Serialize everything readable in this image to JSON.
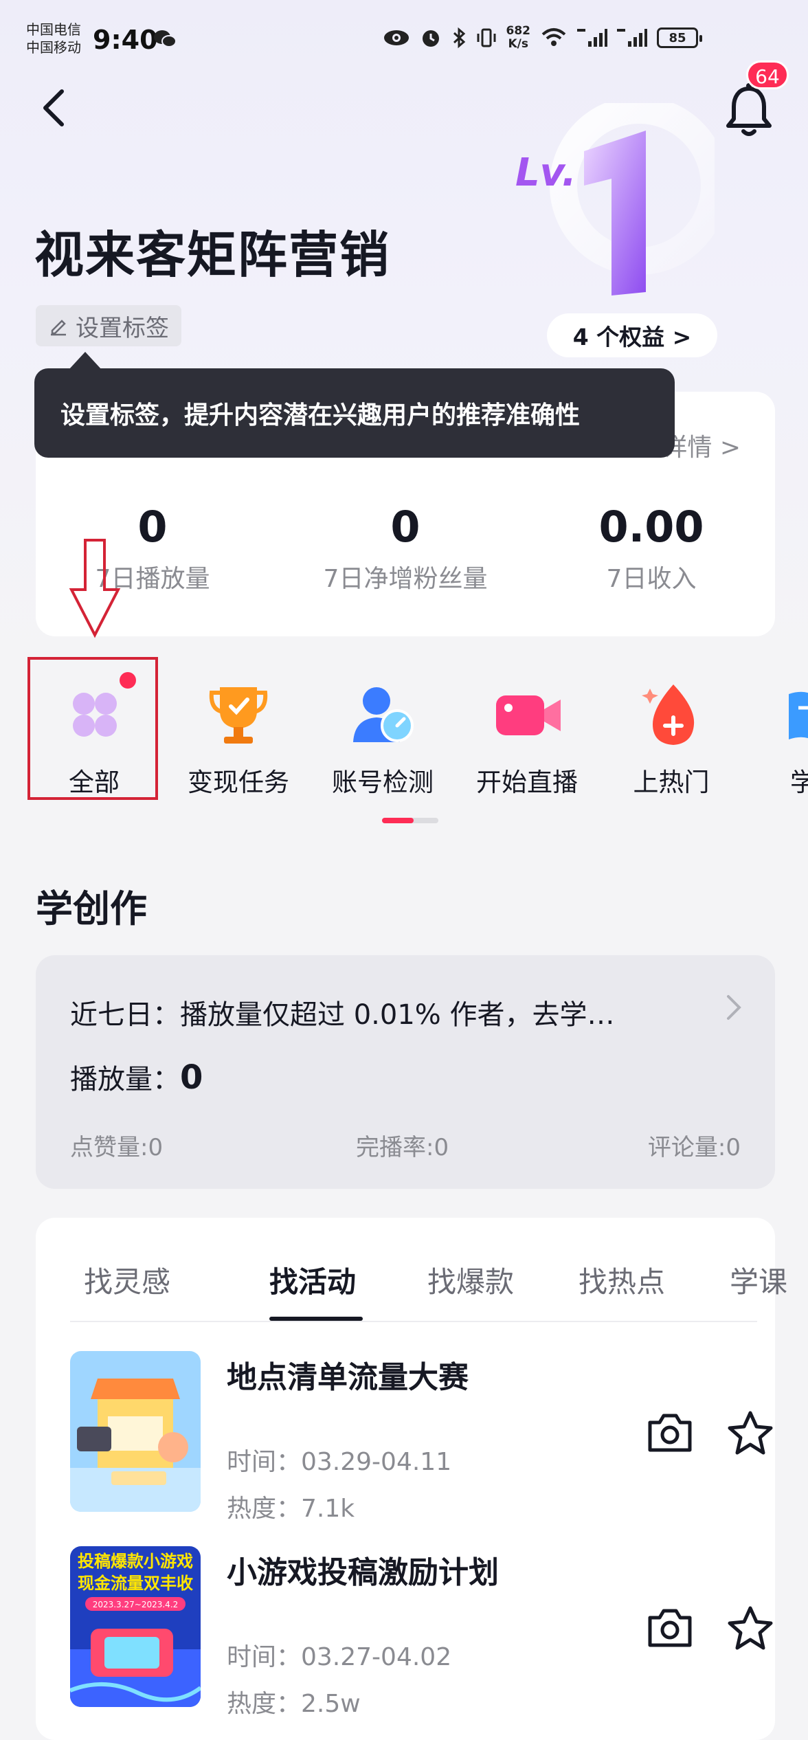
{
  "status_bar": {
    "carrier_1": "中国电信",
    "carrier_2": "中国移动",
    "time": "9:40",
    "net_speed_value": "682",
    "net_speed_unit": "K/s",
    "battery": "85"
  },
  "header": {
    "notification_count": "64",
    "level_badge": "Lv.1"
  },
  "profile": {
    "account_name": "视来客矩阵营销",
    "set_tag_label": "设置标签",
    "rights_label": "4 个权益 >"
  },
  "tooltip": {
    "text": "设置标签，提升内容潜在兴趣用户的推荐准确性"
  },
  "stats": {
    "detail_link": "详情 >",
    "items": [
      {
        "value": "0",
        "label": "7日播放量"
      },
      {
        "value": "0",
        "label": "7日净增粉丝量"
      },
      {
        "value": "0.00",
        "label": "7日收入"
      }
    ]
  },
  "tools": {
    "items": [
      {
        "label": "全部",
        "icon": "grid-icon"
      },
      {
        "label": "变现任务",
        "icon": "trophy-icon"
      },
      {
        "label": "账号检测",
        "icon": "account-check-icon"
      },
      {
        "label": "开始直播",
        "icon": "video-camera-icon"
      },
      {
        "label": "上热门",
        "icon": "fire-drop-icon"
      },
      {
        "label": "学习",
        "icon": "book-icon"
      }
    ],
    "highlight_color": "#d42336"
  },
  "learn": {
    "title": "学创作",
    "summary": "近七日：播放量仅超过 0.01% 作者，去学…",
    "play_label": "播放量：",
    "play_value": "0",
    "metrics": [
      "点赞量:0",
      "完播率:0",
      "评论量:0"
    ]
  },
  "activity": {
    "tabs": [
      {
        "label": "找灵感",
        "active": false
      },
      {
        "label": "找活动",
        "active": true
      },
      {
        "label": "找爆款",
        "active": false
      },
      {
        "label": "找热点",
        "active": false
      },
      {
        "label": "学课",
        "active": false
      }
    ],
    "items": [
      {
        "title": "地点清单流量大赛",
        "time": "时间：03.29-04.11",
        "heat": "热度：7.1k",
        "thumb_icon": "shop-illustration"
      },
      {
        "title": "小游戏投稿激励计划",
        "time": "时间：03.27-04.02",
        "heat": "热度：2.5w",
        "thumb_icon": "game-poster",
        "thumb_text_1": "投稿爆款小游戏",
        "thumb_text_2": "现金流量双丰收",
        "thumb_text_3": "2023.3.27~2023.4.2"
      }
    ]
  },
  "colors": {
    "accent": "#fe2c55",
    "text_primary": "#161823",
    "text_secondary": "#8a8b91",
    "background": "#f4f4f6"
  }
}
